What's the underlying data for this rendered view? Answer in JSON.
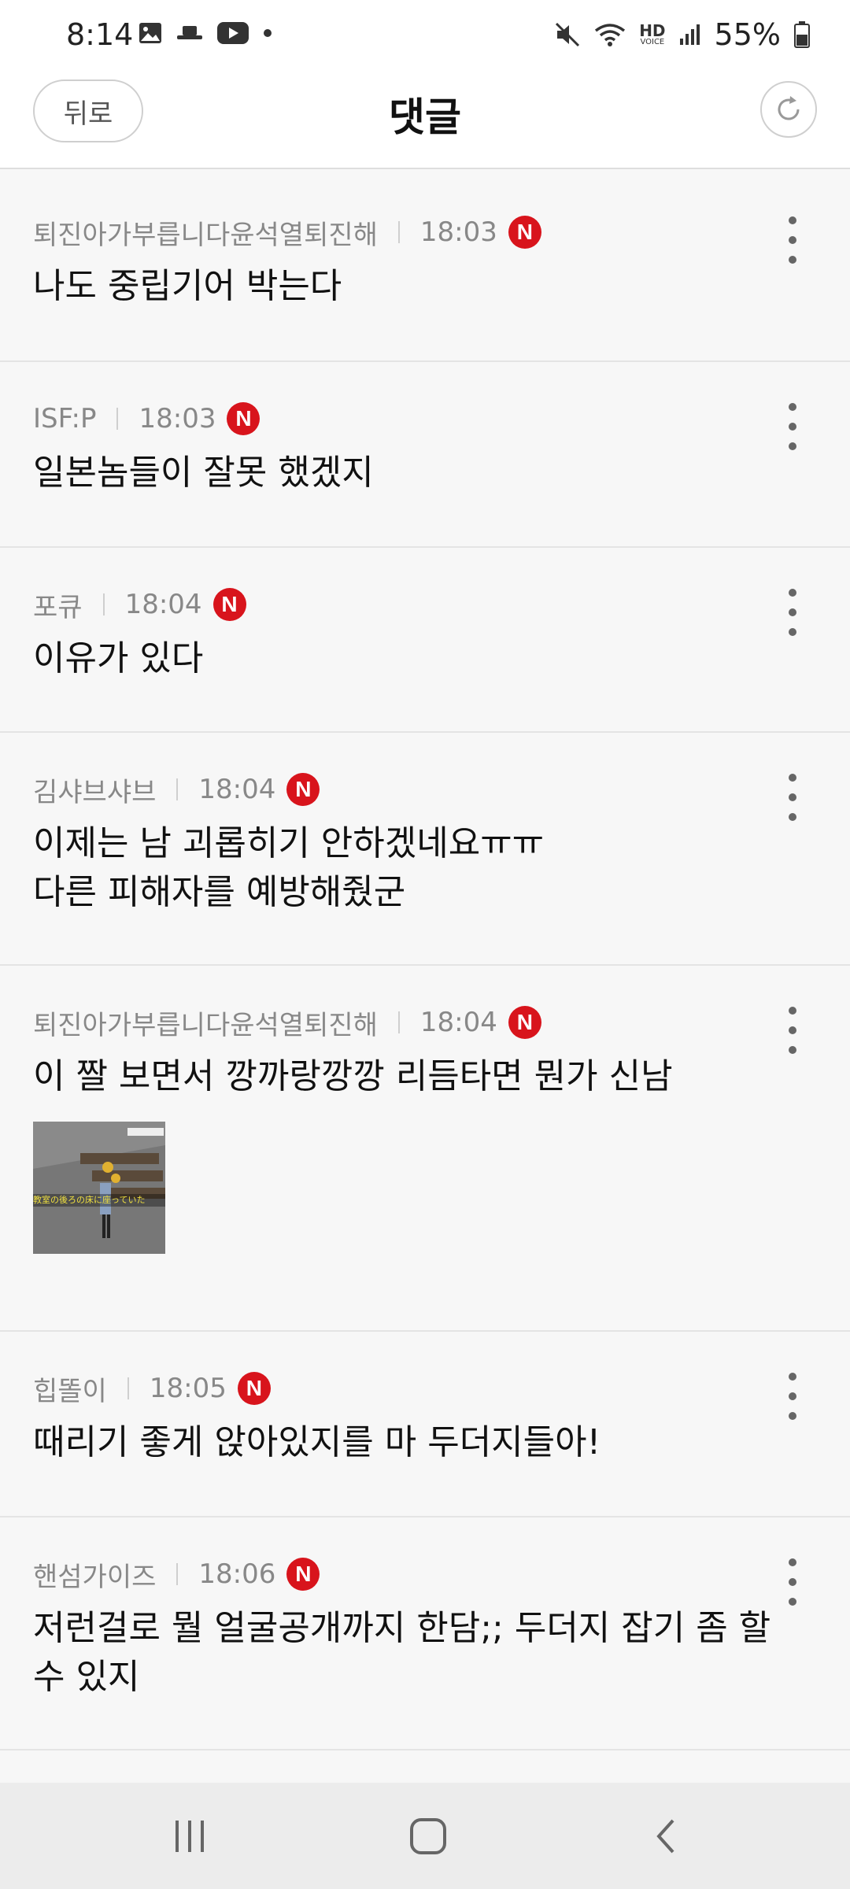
{
  "status_bar": {
    "time": "8:14",
    "battery_percent": "55%",
    "hd_label": "HD",
    "voice_label": "VOICE"
  },
  "header": {
    "back_label": "뒤로",
    "title": "댓글"
  },
  "comments": [
    {
      "author": "퇴진아가부릅니다윤석열퇴진해",
      "time": "18:03",
      "badge": "N",
      "text": "나도 중립기어 박는다"
    },
    {
      "author": "ISF:P",
      "time": "18:03",
      "badge": "N",
      "text": "일본놈들이 잘못 했겠지"
    },
    {
      "author": "포큐",
      "time": "18:04",
      "badge": "N",
      "text": "이유가 있다"
    },
    {
      "author": "김샤브샤브",
      "time": "18:04",
      "badge": "N",
      "text_line1": "이제는 남 괴롭히기 안하겠네요ㅠㅠ",
      "text_line2": "다른 피해자를 예방해줬군"
    },
    {
      "author": "퇴진아가부릅니다윤석열퇴진해",
      "time": "18:04",
      "badge": "N",
      "text": "이 짤 보면서 깡까랑깡깡 리듬타면 뭔가 신남",
      "image_caption": "教室の後ろの床に座っていた"
    },
    {
      "author": "힙똘이",
      "time": "18:05",
      "badge": "N",
      "text": "때리기 좋게 앉아있지를 마 두더지들아!"
    },
    {
      "author": "핸섬가이즈",
      "time": "18:06",
      "badge": "N",
      "text": "저런걸로 뭘 얼굴공개까지 한담;; 두더지 잡기 좀 할 수 있지"
    }
  ],
  "colors": {
    "badge_red": "#d8141c",
    "meta_gray": "#888888",
    "background": "#f7f7f7"
  }
}
